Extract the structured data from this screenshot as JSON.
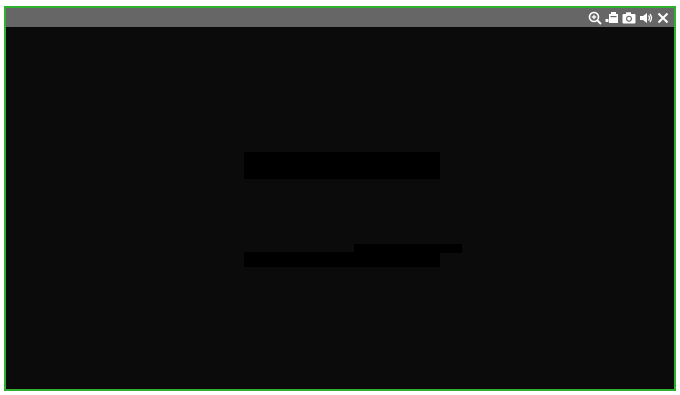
{
  "window": {
    "title": ""
  },
  "toolbar": {
    "icons": [
      "zoom-in-icon",
      "record-icon",
      "snapshot-icon",
      "audio-icon",
      "close-icon"
    ]
  },
  "colors": {
    "border": "#2fb02f",
    "titlebar": "#666666",
    "video_background": "#0b0b0b",
    "icon": "#ffffff"
  }
}
